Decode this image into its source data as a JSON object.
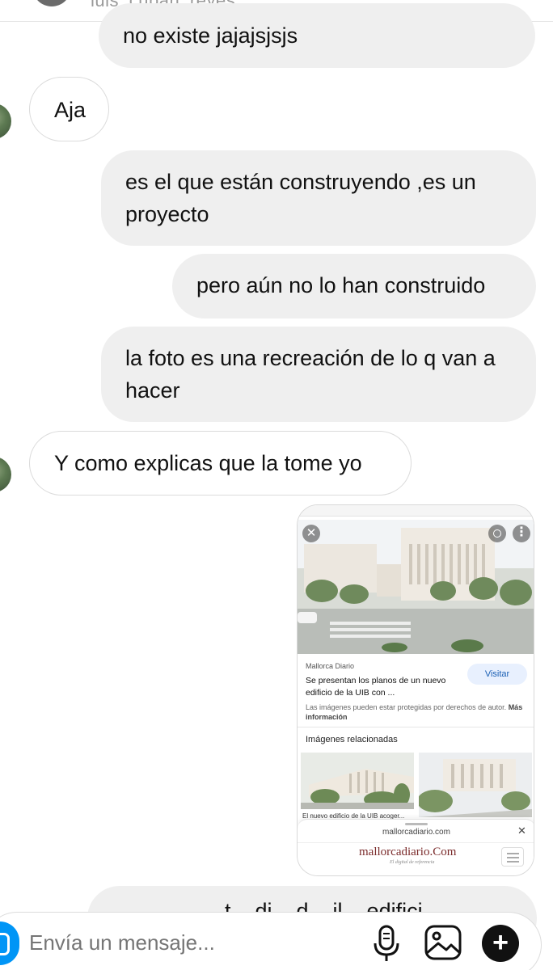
{
  "header": {
    "username": "luis_cuban_reyes"
  },
  "messages": [
    {
      "dir": "out",
      "text": "no existe jajajsjsjs"
    },
    {
      "dir": "in",
      "text": "Aja"
    },
    {
      "dir": "out",
      "text": "es el que están construyendo ,es un proyecto"
    },
    {
      "dir": "out",
      "text": "pero aún no lo han construido"
    },
    {
      "dir": "out",
      "text": "la foto es una recreación de lo q van a hacer"
    },
    {
      "dir": "in",
      "text": "Y como explicas que la tome yo"
    }
  ],
  "shared_screenshot": {
    "source": "Mallorca Diario",
    "title": "Se presentan los planos de un nuevo edificio de la UIB con ...",
    "visit_label": "Visitar",
    "copyright_text": "Las imágenes pueden estar protegidas por derechos de autor.",
    "copyright_more": "Más información",
    "related_title": "Imágenes relacionadas",
    "related_caption": "El nuevo edificio de la UIB acoger...",
    "url": "mallorcadiario.com",
    "logo_text": "mallorcadiario.Com",
    "logo_tagline": "El digital de referencia"
  },
  "partial_message": "... t... di... d... il... edifici...",
  "composer": {
    "placeholder": "Envía un mensaje..."
  },
  "icons": {
    "camera": "camera-icon",
    "mic": "microphone-icon",
    "gallery": "image-icon",
    "plus": "plus-icon"
  },
  "colors": {
    "accent": "#0095f6",
    "bubble_out": "#efefef",
    "border": "#dbdbdb"
  }
}
